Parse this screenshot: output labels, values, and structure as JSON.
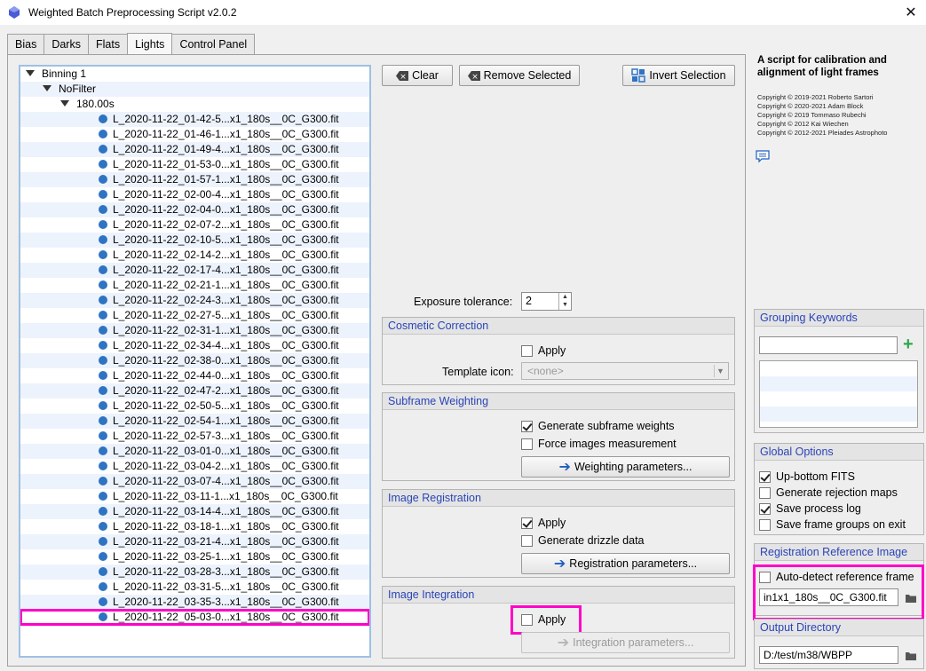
{
  "window": {
    "title": "Weighted Batch Preprocessing Script v2.0.2"
  },
  "tabs": [
    {
      "label": "Bias"
    },
    {
      "label": "Darks"
    },
    {
      "label": "Flats"
    },
    {
      "label": "Lights"
    },
    {
      "label": "Control Panel"
    }
  ],
  "tree": {
    "binning": "Binning 1",
    "filter": "NoFilter",
    "exposure": "180.00s",
    "files": [
      "L_2020-11-22_01-42-5...x1_180s__0C_G300.fit",
      "L_2020-11-22_01-46-1...x1_180s__0C_G300.fit",
      "L_2020-11-22_01-49-4...x1_180s__0C_G300.fit",
      "L_2020-11-22_01-53-0...x1_180s__0C_G300.fit",
      "L_2020-11-22_01-57-1...x1_180s__0C_G300.fit",
      "L_2020-11-22_02-00-4...x1_180s__0C_G300.fit",
      "L_2020-11-22_02-04-0...x1_180s__0C_G300.fit",
      "L_2020-11-22_02-07-2...x1_180s__0C_G300.fit",
      "L_2020-11-22_02-10-5...x1_180s__0C_G300.fit",
      "L_2020-11-22_02-14-2...x1_180s__0C_G300.fit",
      "L_2020-11-22_02-17-4...x1_180s__0C_G300.fit",
      "L_2020-11-22_02-21-1...x1_180s__0C_G300.fit",
      "L_2020-11-22_02-24-3...x1_180s__0C_G300.fit",
      "L_2020-11-22_02-27-5...x1_180s__0C_G300.fit",
      "L_2020-11-22_02-31-1...x1_180s__0C_G300.fit",
      "L_2020-11-22_02-34-4...x1_180s__0C_G300.fit",
      "L_2020-11-22_02-38-0...x1_180s__0C_G300.fit",
      "L_2020-11-22_02-44-0...x1_180s__0C_G300.fit",
      "L_2020-11-22_02-47-2...x1_180s__0C_G300.fit",
      "L_2020-11-22_02-50-5...x1_180s__0C_G300.fit",
      "L_2020-11-22_02-54-1...x1_180s__0C_G300.fit",
      "L_2020-11-22_02-57-3...x1_180s__0C_G300.fit",
      "L_2020-11-22_03-01-0...x1_180s__0C_G300.fit",
      "L_2020-11-22_03-04-2...x1_180s__0C_G300.fit",
      "L_2020-11-22_03-07-4...x1_180s__0C_G300.fit",
      "L_2020-11-22_03-11-1...x1_180s__0C_G300.fit",
      "L_2020-11-22_03-14-4...x1_180s__0C_G300.fit",
      "L_2020-11-22_03-18-1...x1_180s__0C_G300.fit",
      "L_2020-11-22_03-21-4...x1_180s__0C_G300.fit",
      "L_2020-11-22_03-25-1...x1_180s__0C_G300.fit",
      "L_2020-11-22_03-28-3...x1_180s__0C_G300.fit",
      "L_2020-11-22_03-31-5...x1_180s__0C_G300.fit",
      "L_2020-11-22_03-35-3...x1_180s__0C_G300.fit",
      "L_2020-11-22_05-03-0...x1_180s__0C_G300.fit"
    ]
  },
  "toolbar": {
    "clear_label": "Clear",
    "remove_selected_label": "Remove Selected",
    "invert_selection_label": "Invert Selection"
  },
  "exposure_tolerance": {
    "label": "Exposure tolerance:",
    "value": "2"
  },
  "cosmetic_correction": {
    "title": "Cosmetic Correction",
    "apply_label": "Apply",
    "apply_checked": false,
    "template_label": "Template icon:",
    "template_value": "<none>"
  },
  "subframe_weighting": {
    "title": "Subframe Weighting",
    "generate_label": "Generate subframe weights",
    "generate_checked": true,
    "force_label": "Force images measurement",
    "force_checked": false,
    "params_button": "Weighting parameters..."
  },
  "image_registration": {
    "title": "Image Registration",
    "apply_label": "Apply",
    "apply_checked": true,
    "drizzle_label": "Generate drizzle data",
    "drizzle_checked": false,
    "params_button": "Registration parameters..."
  },
  "image_integration": {
    "title": "Image Integration",
    "apply_label": "Apply",
    "apply_checked": false,
    "params_button": "Integration parameters..."
  },
  "description": {
    "title": "A script for calibration and alignment of light frames",
    "copyrights": [
      "Copyright © 2019-2021 Roberto Sartori",
      "Copyright © 2020-2021 Adam Block",
      "Copyright © 2019 Tommaso Rubechi",
      "Copyright © 2012 Kai Wiechen",
      "Copyright © 2012-2021 Pleiades Astrophoto"
    ]
  },
  "grouping_keywords": {
    "title": "Grouping Keywords",
    "input_value": ""
  },
  "global_options": {
    "title": "Global Options",
    "options": [
      {
        "label": "Up-bottom FITS",
        "checked": true
      },
      {
        "label": "Generate rejection maps",
        "checked": false
      },
      {
        "label": "Save process log",
        "checked": true
      },
      {
        "label": "Save frame groups on exit",
        "checked": false
      }
    ]
  },
  "registration_reference": {
    "title": "Registration Reference Image",
    "auto_detect_label": "Auto-detect reference frame",
    "auto_detect_checked": false,
    "file_value": "in1x1_180s__0C_G300.fit"
  },
  "output_directory": {
    "title": "Output Directory",
    "path": "D:/test/m38/WBPP"
  },
  "colors": {
    "accent": "#2a44b8",
    "highlight": "#ff00c8",
    "dot": "#2f74c3",
    "tree_border": "#9ec0e6"
  }
}
